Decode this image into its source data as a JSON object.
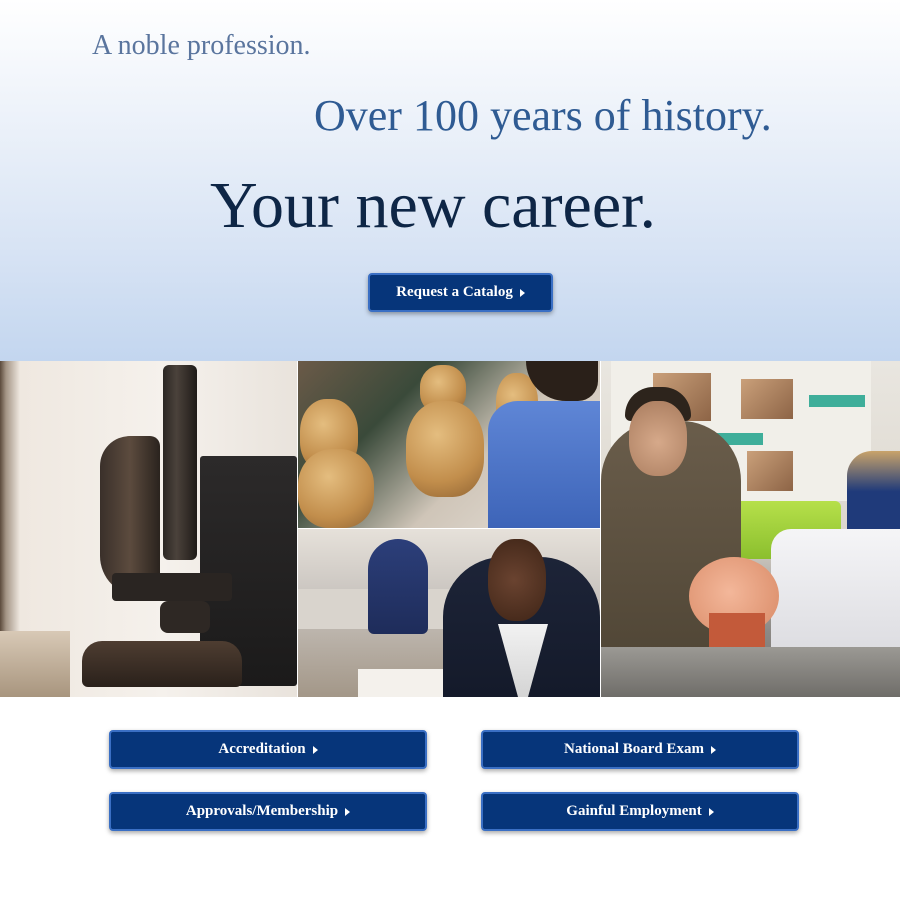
{
  "hero": {
    "tagline_1": "A noble profession.",
    "tagline_2": "Over 100 years of history.",
    "headline": "Your new career.",
    "cta_label": "Request a Catalog"
  },
  "photos": [
    {
      "subject": "microscope"
    },
    {
      "subject": "students sculpting clay heads"
    },
    {
      "subject": "student writing in classroom"
    },
    {
      "subject": "instructor demonstrating on training mannequin"
    }
  ],
  "links": {
    "accreditation": "Accreditation",
    "national_board_exam": "National Board Exam",
    "approvals_membership": "Approvals/Membership",
    "gainful_employment": "Gainful Employment"
  },
  "colors": {
    "button_bg": "#06357a",
    "button_border": "#3a6fc4",
    "headline": "#0e2646",
    "tagline_2": "#2f5b93",
    "tagline_1": "#5a759e"
  },
  "icons": {
    "button_caret": "caret-right-icon"
  }
}
